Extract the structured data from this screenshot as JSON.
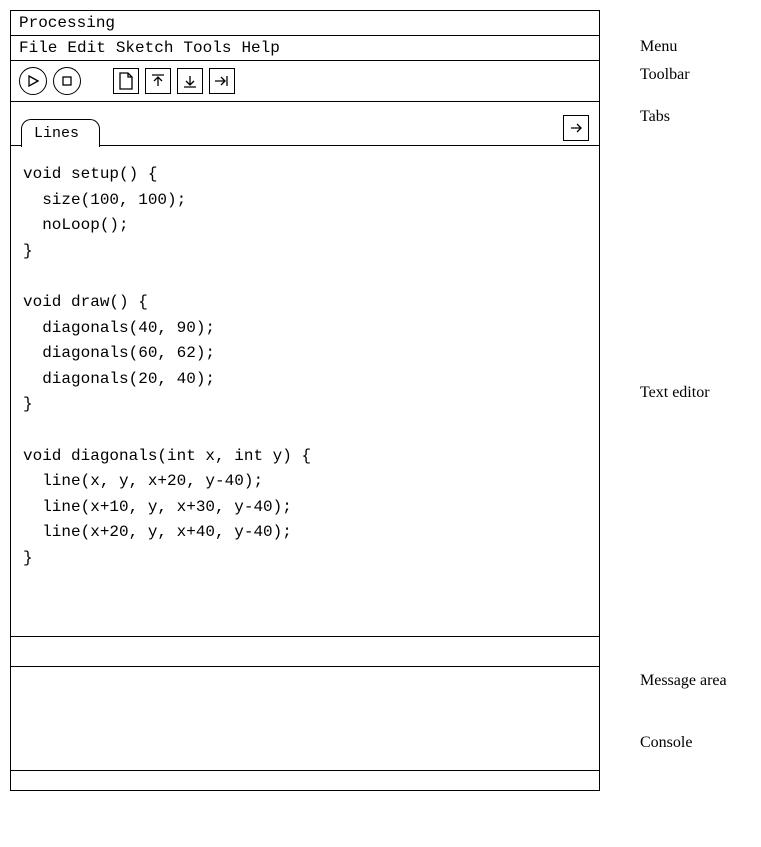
{
  "title": "Processing",
  "menu": {
    "items": [
      "File",
      "Edit",
      "Sketch",
      "Tools",
      "Help"
    ]
  },
  "tabs": {
    "active": "Lines"
  },
  "editor": {
    "code": "void setup() {\n  size(100, 100);\n  noLoop();\n}\n\nvoid draw() {\n  diagonals(40, 90);\n  diagonals(60, 62);\n  diagonals(20, 40);\n}\n\nvoid diagonals(int x, int y) {\n  line(x, y, x+20, y-40);\n  line(x+10, y, x+30, y-40);\n  line(x+20, y, x+40, y-40);\n}"
  },
  "annotations": {
    "menu": "Menu",
    "toolbar": "Toolbar",
    "tabs": "Tabs",
    "editor": "Text editor",
    "message": "Message area",
    "console": "Console"
  }
}
